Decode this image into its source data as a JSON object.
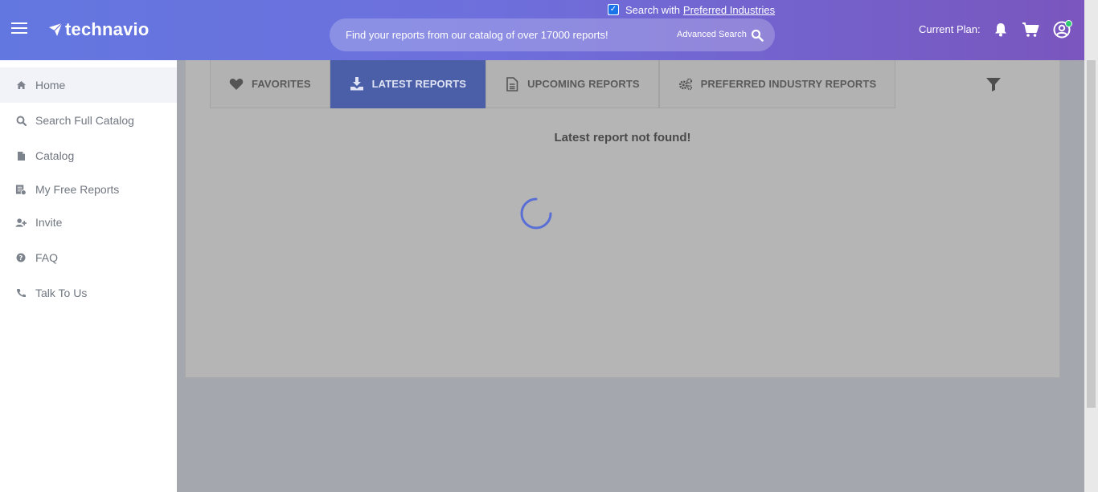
{
  "header": {
    "logo_text": "technavio",
    "preferred": {
      "prefix": "Search with",
      "link": "Preferred Industries",
      "checked": true
    },
    "search": {
      "placeholder": "Find your reports from our catalog of over 17000 reports!",
      "advanced_label": "Advanced Search"
    },
    "current_plan_label": "Current Plan:",
    "icons": [
      "bell-icon",
      "cart-icon",
      "user-icon"
    ],
    "accent_colors": {
      "gradient_start": "#6377e0",
      "gradient_end": "#7a55bd",
      "online_status": "#2ecc71"
    }
  },
  "sidebar": {
    "items": [
      {
        "label": "Home",
        "icon": "home-icon",
        "active": true
      },
      {
        "label": "Search Full Catalog",
        "icon": "search-icon"
      },
      {
        "label": "Catalog",
        "icon": "file-icon"
      },
      {
        "label": "My Free Reports",
        "icon": "report-check-icon"
      },
      {
        "label": "Invite",
        "icon": "user-plus-icon"
      },
      {
        "label": "FAQ",
        "icon": "question-circle-icon"
      },
      {
        "label": "Talk To Us",
        "icon": "phone-icon"
      }
    ]
  },
  "main": {
    "tabs": [
      {
        "label": "FAVORITES",
        "icon": "heart-icon"
      },
      {
        "label": "LATEST REPORTS",
        "icon": "download-icon",
        "active": true
      },
      {
        "label": "UPCOMING REPORTS",
        "icon": "document-icon"
      },
      {
        "label": "PREFERRED INDUSTRY REPORTS",
        "icon": "gears-icon"
      }
    ],
    "empty_message": "Latest report not found!",
    "active_tab_color": "#4b5fa9",
    "loading": true
  }
}
